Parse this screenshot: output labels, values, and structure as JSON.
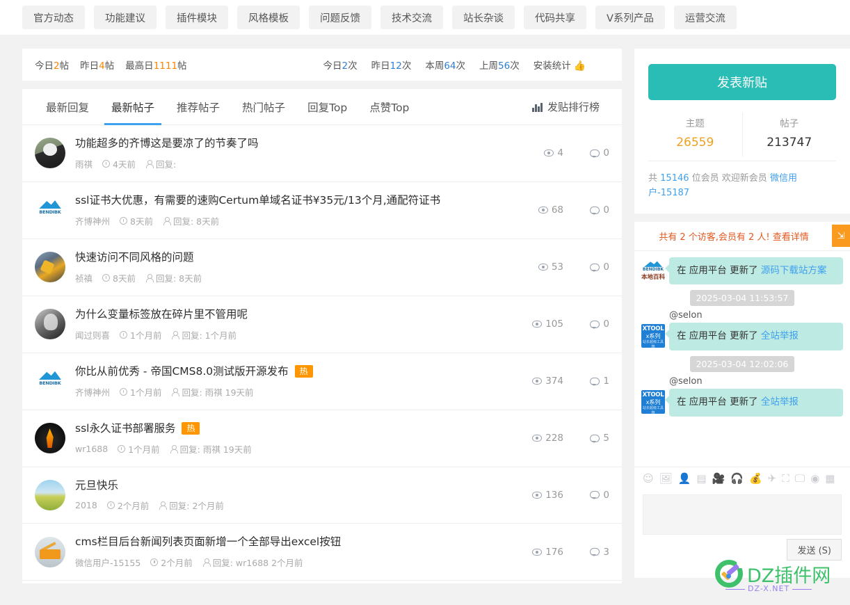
{
  "categories": [
    "官方动态",
    "功能建议",
    "插件模块",
    "风格模板",
    "问题反馈",
    "技术交流",
    "站长杂谈",
    "代码共享",
    "V系列产品",
    "运营交流"
  ],
  "stats": {
    "left": [
      {
        "label_a": "今日",
        "value": "2",
        "label_b": "帖",
        "color": "orange"
      },
      {
        "label_a": "昨日",
        "value": "4",
        "label_b": "帖",
        "color": "orange"
      },
      {
        "label_a": "最高日",
        "value": "1111",
        "label_b": "帖",
        "color": "orange"
      }
    ],
    "right": [
      {
        "label_a": "今日",
        "value": "2",
        "label_b": "次",
        "color": "blue"
      },
      {
        "label_a": "昨日",
        "value": "12",
        "label_b": "次",
        "color": "blue"
      },
      {
        "label_a": "本周",
        "value": "64",
        "label_b": "次",
        "color": "blue"
      },
      {
        "label_a": "上周",
        "value": "56",
        "label_b": "次",
        "color": "blue"
      }
    ],
    "install_label": "安装统计",
    "install_icon": "thumbs-up-icon"
  },
  "tabs": [
    {
      "label": "最新回复",
      "active": false
    },
    {
      "label": "最新帖子",
      "active": true
    },
    {
      "label": "推荐帖子",
      "active": false
    },
    {
      "label": "热门帖子",
      "active": false
    },
    {
      "label": "回复Top",
      "active": false
    },
    {
      "label": "点赞Top",
      "active": false
    }
  ],
  "rank_link": {
    "label": "发贴排行榜",
    "icon": "bar-chart-icon"
  },
  "posts": [
    {
      "title": "功能超多的齐博这是要凉了的节奏了吗",
      "badge": "",
      "author": "雨祺",
      "time": "4天前",
      "reply": "回复:",
      "views": "4",
      "comments": "0",
      "avatar": "av-panda"
    },
    {
      "title": "ssl证书大优惠，有需要的速购Certum单域名证书¥35元/13个月,通配符证书",
      "badge": "",
      "author": "齐博神州",
      "time": "8天前",
      "reply": "回复: 8天前",
      "views": "68",
      "comments": "0",
      "avatar": "av-bendibk"
    },
    {
      "title": "快速访问不同风格的问题",
      "badge": "",
      "author": "祯禛",
      "time": "8天前",
      "reply": "回复: 8天前",
      "views": "53",
      "comments": "0",
      "avatar": "av-moto"
    },
    {
      "title": "为什么变量标签放在碎片里不管用呢",
      "badge": "",
      "author": "闻过则喜",
      "time": "1个月前",
      "reply": "回复: 1个月前",
      "views": "105",
      "comments": "0",
      "avatar": "av-portrait"
    },
    {
      "title": "你比从前优秀 - 帝国CMS8.0测试版开源发布",
      "badge": "热",
      "author": "齐博神州",
      "time": "1个月前",
      "reply": "回复: 雨祺 19天前",
      "views": "374",
      "comments": "1",
      "avatar": "av-bendibk"
    },
    {
      "title": "ssl永久证书部署服务",
      "badge": "热",
      "author": "wr1688",
      "time": "1个月前",
      "reply": "回复: 雨祺 19天前",
      "views": "228",
      "comments": "5",
      "avatar": "av-fire"
    },
    {
      "title": "元旦快乐",
      "badge": "",
      "author": "2018",
      "time": "2个月前",
      "reply": "回复: 2个月前",
      "views": "136",
      "comments": "0",
      "avatar": "av-field"
    },
    {
      "title": "cms栏目后台新闻列表页面新增一个全部导出excel按钮",
      "badge": "",
      "author": "微信用户-15155",
      "time": "2个月前",
      "reply": "回复: wr1688 2个月前",
      "views": "176",
      "comments": "3",
      "avatar": "av-truck"
    }
  ],
  "sidebar": {
    "post_button": "发表新贴",
    "counts": [
      {
        "label": "主题",
        "value": "26559"
      },
      {
        "label": "帖子",
        "value": "213747"
      }
    ],
    "members_prefix": "共",
    "members_count": "15146",
    "members_mid": "位会员 欢迎新会员",
    "members_newest": "微信用户-15187"
  },
  "chat": {
    "header": "共有 2 个访客,会员有 2 人!",
    "header_link": "查看详情",
    "expand_icon": "expand-icon",
    "messages": [
      {
        "kind": "msg",
        "avatar": "ma-bendibk",
        "avatar_l1": "BENDIBK",
        "avatar_l2": "本地百科",
        "at": "",
        "text_prefix": "在 应用平台 更新了 ",
        "text_link": "源码下载站方案"
      },
      {
        "kind": "time",
        "value": "2025-03-04 11:53:57"
      },
      {
        "kind": "msg",
        "avatar": "ma-xtool",
        "avatar_l1": "XTOOL",
        "avatar_l2": "x系列",
        "avatar_l3": "站长超级工具箱",
        "at": "@selon",
        "text_prefix": "在 应用平台 更新了 ",
        "text_link": "全站举报"
      },
      {
        "kind": "time",
        "value": "2025-03-04 12:02:06"
      },
      {
        "kind": "msg",
        "avatar": "ma-xtool",
        "avatar_l1": "XTOOL",
        "avatar_l2": "x系列",
        "avatar_l3": "站长超级工具箱",
        "at": "@selon",
        "text_prefix": "在 应用平台 更新了 ",
        "text_link": "全站举报"
      }
    ],
    "tools": [
      {
        "name": "emoji-icon",
        "glyph": "☺"
      },
      {
        "name": "image-icon",
        "glyph": "🖼"
      },
      {
        "name": "add-user-icon",
        "glyph": "👤"
      },
      {
        "name": "list-icon",
        "glyph": "▤"
      },
      {
        "name": "video-icon",
        "glyph": "🎥"
      },
      {
        "name": "headphone-icon",
        "glyph": "🎧"
      },
      {
        "name": "money-bag-icon",
        "glyph": "💰"
      },
      {
        "name": "rocket-icon",
        "glyph": "✈"
      },
      {
        "name": "crop-icon",
        "glyph": "⛶"
      },
      {
        "name": "monitor-icon",
        "glyph": "🖵"
      },
      {
        "name": "coin-icon",
        "glyph": "◉"
      },
      {
        "name": "calculator-icon",
        "glyph": "▦"
      }
    ],
    "input_placeholder": "",
    "send_label": "发送 (S)"
  },
  "watermark": {
    "text": "DZ插件网",
    "sub": "DZ-X.NET"
  },
  "colors": {
    "accent_blue": "#3fa0ee",
    "teal_button": "#29bdb6",
    "hot_badge": "#ff9600",
    "orange_number": "#ff8400",
    "chat_bubble": "#bdeae2",
    "chat_header_text": "#e2581e",
    "expand_orange": "#fa9a1e",
    "watermark_green": "#3ec16a"
  }
}
